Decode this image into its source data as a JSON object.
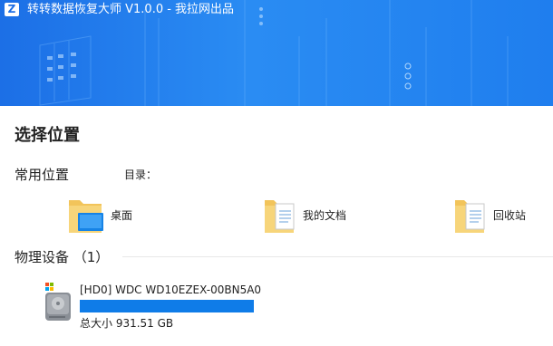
{
  "window": {
    "title": "转转数据恢复大师 V1.0.0 - 我拉网出品",
    "logo_letter": "Z"
  },
  "main": {
    "title": "选择位置",
    "common_locations": {
      "title": "常用位置",
      "directory_label": "目录：",
      "items": [
        {
          "label": "桌面",
          "icon": "desktop-folder-icon"
        },
        {
          "label": "我的文档",
          "icon": "documents-folder-icon"
        },
        {
          "label": "回收站",
          "icon": "recycle-bin-folder-icon"
        }
      ]
    },
    "physical_devices": {
      "title": "物理设备 （1）",
      "disks": [
        {
          "name": "[HD0] WDC WD10EZEX-00BN5A0",
          "size": "总大小 931.51 GB",
          "usage_fraction": 1.0,
          "icon": "hard-disk-icon"
        }
      ]
    }
  },
  "colors": {
    "banner": "#2a8cf3",
    "accent": "#0f7ce8"
  }
}
